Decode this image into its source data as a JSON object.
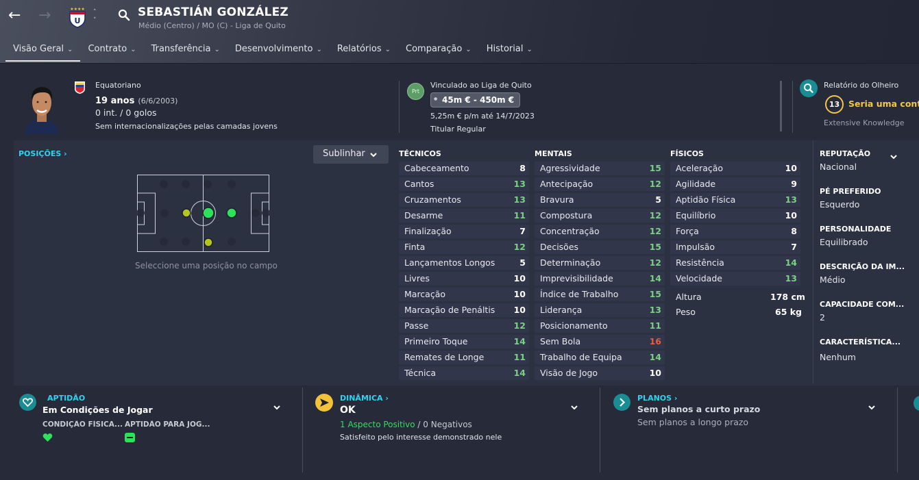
{
  "header": {
    "player_name": "SEBASTIÁN GONZÁLEZ",
    "subtitle": "Médio (Centro) / MO (C) - Liga de Quito",
    "tabs": [
      {
        "label": "Visão Geral"
      },
      {
        "label": "Contrato"
      },
      {
        "label": "Transferência"
      },
      {
        "label": "Desenvolvimento"
      },
      {
        "label": "Relatórios"
      },
      {
        "label": "Comparação"
      },
      {
        "label": "Historial"
      }
    ]
  },
  "info": {
    "nationality": "Equatoriano",
    "age": "19 anos",
    "birthdate": "(6/6/2003)",
    "caps": "0 int. / 0 golos",
    "youth_caps": "Sem internacionalizações pelas camadas jovens",
    "contract_badge": "Prt",
    "contract_club": "Vinculado ao Liga de Quito",
    "value_range": "45m € - 450m €",
    "wage": "5,25m € p/m até 14/7/2023",
    "squad_status": "Titular Regular",
    "scout_title": "Relatório do Olheiro",
    "scout_rating": "13",
    "scout_verdict": "Seria uma contra",
    "scout_knowledge": "Extensive Knowledge"
  },
  "positions": {
    "link": "POSIÇÕES",
    "dropdown": "Sublinhar",
    "caption": "Seleccione uma posição no campo"
  },
  "attributes": {
    "technical": {
      "title": "TÉCNICOS",
      "rows": [
        {
          "name": "Cabeceamento",
          "value": "8",
          "tone": "white"
        },
        {
          "name": "Cantos",
          "value": "13",
          "tone": "green"
        },
        {
          "name": "Cruzamentos",
          "value": "13",
          "tone": "green"
        },
        {
          "name": "Desarme",
          "value": "11",
          "tone": "green"
        },
        {
          "name": "Finalização",
          "value": "7",
          "tone": "white"
        },
        {
          "name": "Finta",
          "value": "12",
          "tone": "green"
        },
        {
          "name": "Lançamentos Longos",
          "value": "5",
          "tone": "white"
        },
        {
          "name": "Livres",
          "value": "10",
          "tone": "white"
        },
        {
          "name": "Marcação",
          "value": "10",
          "tone": "white"
        },
        {
          "name": "Marcação de Penáltis",
          "value": "10",
          "tone": "white"
        },
        {
          "name": "Passe",
          "value": "12",
          "tone": "green"
        },
        {
          "name": "Primeiro Toque",
          "value": "14",
          "tone": "green"
        },
        {
          "name": "Remates de Longe",
          "value": "11",
          "tone": "green"
        },
        {
          "name": "Técnica",
          "value": "14",
          "tone": "green"
        }
      ]
    },
    "mental": {
      "title": "MENTAIS",
      "rows": [
        {
          "name": "Agressividade",
          "value": "15",
          "tone": "green"
        },
        {
          "name": "Antecipação",
          "value": "12",
          "tone": "green"
        },
        {
          "name": "Bravura",
          "value": "5",
          "tone": "white"
        },
        {
          "name": "Compostura",
          "value": "12",
          "tone": "green"
        },
        {
          "name": "Concentração",
          "value": "12",
          "tone": "green"
        },
        {
          "name": "Decisões",
          "value": "15",
          "tone": "green"
        },
        {
          "name": "Determinação",
          "value": "12",
          "tone": "green"
        },
        {
          "name": "Imprevisibilidade",
          "value": "14",
          "tone": "green"
        },
        {
          "name": "Índice de Trabalho",
          "value": "15",
          "tone": "green"
        },
        {
          "name": "Liderança",
          "value": "13",
          "tone": "green"
        },
        {
          "name": "Posicionamento",
          "value": "11",
          "tone": "green"
        },
        {
          "name": "Sem Bola",
          "value": "16",
          "tone": "red"
        },
        {
          "name": "Trabalho de Equipa",
          "value": "14",
          "tone": "green"
        },
        {
          "name": "Visão de Jogo",
          "value": "10",
          "tone": "white"
        }
      ]
    },
    "physical": {
      "title": "FÍSICOS",
      "rows": [
        {
          "name": "Aceleração",
          "value": "10",
          "tone": "white"
        },
        {
          "name": "Agilidade",
          "value": "9",
          "tone": "white"
        },
        {
          "name": "Aptidão Física",
          "value": "13",
          "tone": "green"
        },
        {
          "name": "Equilíbrio",
          "value": "10",
          "tone": "white"
        },
        {
          "name": "Força",
          "value": "8",
          "tone": "white"
        },
        {
          "name": "Impulsão",
          "value": "7",
          "tone": "white"
        },
        {
          "name": "Resistência",
          "value": "14",
          "tone": "green"
        },
        {
          "name": "Velocidade",
          "value": "13",
          "tone": "green"
        }
      ],
      "height_label": "Altura",
      "height_value": "178 cm",
      "weight_label": "Peso",
      "weight_value": "65 kg"
    }
  },
  "side": {
    "reputation_label": "REPUTAÇÃO",
    "reputation_value": "Nacional",
    "foot_label": "PÉ PREFERIDO",
    "foot_value": "Esquerdo",
    "personality_label": "PERSONALIDADE",
    "personality_value": "Equilibrado",
    "media_label": "DESCRIÇÃO DA IM...",
    "media_value": "Médio",
    "capacity_label": "CAPACIDADE COM...",
    "capacity_value": "2",
    "traits_label": "CARACTERÍSTICA...",
    "traits_value": "Nenhum"
  },
  "bottom": {
    "fitness_title": "APTIDÃO",
    "fitness_value": "Em Condições de Jogar",
    "fitness_cond_label": "CONDIÇÃO FÍSICA...",
    "fitness_match_label": "APTIDÃO PARA JOG...",
    "dynamics_title": "DINÂMICA",
    "dynamics_value": "OK",
    "dynamics_positive": "1 Aspecto Positivo",
    "dynamics_slash": "/",
    "dynamics_negative": "0 Negativos",
    "dynamics_note": "Satisfeito pelo interesse demonstrado nele",
    "plans_title": "PLANOS",
    "plans_short": "Sem planos a curto prazo",
    "plans_long": "Sem planos a longo prazo"
  },
  "colors": {
    "accent_cyan": "#2fd3f2",
    "attr_green": "#7cd086",
    "attr_red": "#f05a3a",
    "panel_bg": "#2c3141",
    "page_bg": "#262a39"
  }
}
